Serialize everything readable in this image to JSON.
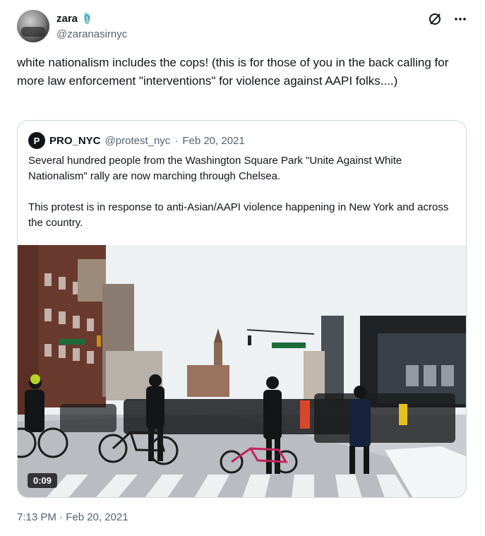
{
  "author": {
    "display_name": "zara",
    "emoji_icon": "flip-flop-icon",
    "handle": "@zaranasirnyc"
  },
  "toolbar": {
    "grok_icon": "slash-circle-icon",
    "more_icon": "more-icon"
  },
  "tweet": {
    "text": "white nationalism includes the cops! (this is for those of you in the back calling for more law enforcement \"interventions\" for violence against AAPI folks....)",
    "timestamp": "7:13 PM · Feb 20, 2021"
  },
  "quote": {
    "avatar_letter": "P",
    "display_name": "PRO_NYC",
    "handle": "@protest_nyc",
    "date": "Feb 20, 2021",
    "separator": "·",
    "text": "Several hundred people from the Washington Square Park \"Unite Against White Nationalism\" rally are now marching through Chelsea.\n\nThis protest is in response to anti-Asian/AAPI violence happening in New York and across the country.",
    "video": {
      "duration": "0:09"
    }
  }
}
